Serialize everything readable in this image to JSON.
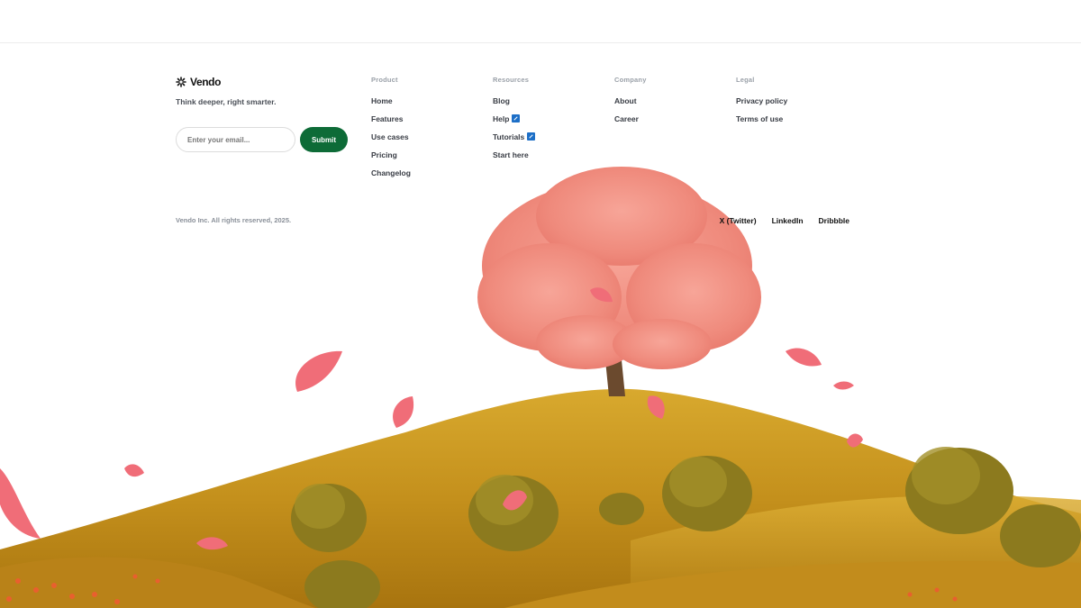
{
  "brand": {
    "name": "Vendo",
    "tagline": "Think deeper, right smarter."
  },
  "signup": {
    "email_placeholder": "Enter your email...",
    "submit_label": "Submit"
  },
  "columns": [
    {
      "heading": "Product",
      "items": [
        "Home",
        "Features",
        "Use cases",
        "Pricing",
        "Changelog"
      ]
    },
    {
      "heading": "Resources",
      "items": [
        "Blog",
        "Help",
        "Tutorials",
        "Start here"
      ]
    },
    {
      "heading": "Company",
      "items": [
        "About",
        "Career"
      ]
    },
    {
      "heading": "Legal",
      "items": [
        "Privacy policy",
        "Terms of use"
      ]
    }
  ],
  "copyright": "Vendo Inc. All rights reserved, 2025.",
  "socials": [
    "X (Twitter)",
    "LinkedIn",
    "Dribbble"
  ],
  "colors": {
    "accent": "#0d6b37",
    "link_icon": "#1d6fc7",
    "hill": "#c99a1e",
    "blossom": "#f29a8e"
  },
  "icons": {
    "brand": "sparkle-logo-icon",
    "external": "external-link-icon"
  }
}
